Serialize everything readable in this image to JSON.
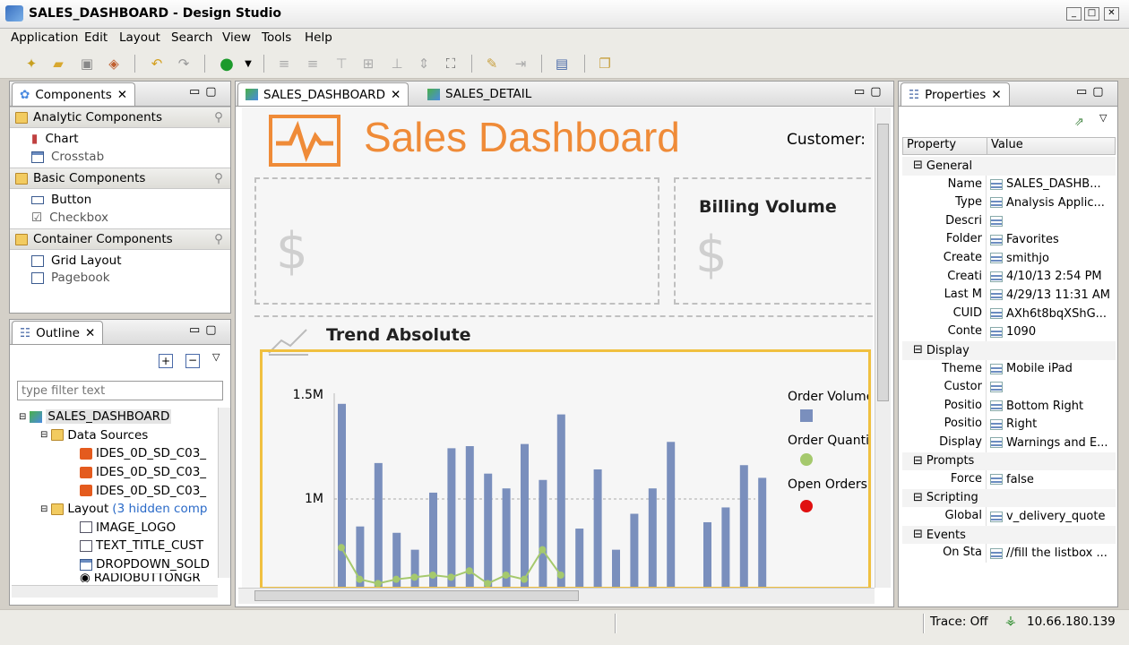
{
  "window": {
    "title": "SALES_DASHBOARD - Design Studio",
    "controls": [
      "_",
      "□",
      "✕"
    ]
  },
  "menu": [
    "Application",
    "Edit",
    "Layout",
    "Search",
    "View",
    "Tools",
    "Help"
  ],
  "components_panel": {
    "title": "Components",
    "groups": [
      {
        "label": "Analytic Components",
        "items": [
          "Chart",
          "Crosstab"
        ]
      },
      {
        "label": "Basic Components",
        "items": [
          "Button",
          "Checkbox"
        ]
      },
      {
        "label": "Container Components",
        "items": [
          "Grid Layout",
          "Pagebook"
        ]
      }
    ]
  },
  "outline_panel": {
    "title": "Outline",
    "filter_placeholder": "type filter text",
    "root": "SALES_DASHBOARD",
    "data_sources_label": "Data Sources",
    "data_sources": [
      "IDES_0D_SD_C03_",
      "IDES_0D_SD_C03_",
      "IDES_0D_SD_C03_"
    ],
    "layout_label": "Layout",
    "layout_hint": "(3 hidden comp",
    "layout_items": [
      "IMAGE_LOGO",
      "TEXT_TITLE_CUST",
      "DROPDOWN_SOLD",
      "RADIOBUTTONGR"
    ]
  },
  "editor": {
    "tabs": [
      "SALES_DASHBOARD",
      "SALES_DETAIL"
    ],
    "header_title": "Sales Dashboard",
    "customer_label": "Customer:",
    "billing_title": "Billing Volume",
    "dollar": "$",
    "trend_title": "Trend Absolute"
  },
  "chart_data": {
    "type": "bar",
    "ylabels": [
      "1.5M",
      "1M"
    ],
    "legend": [
      "Order Volume",
      "Order Quantit",
      "Open Orders"
    ],
    "colors": {
      "bar": "#7a8fbd",
      "line": "#a5c96d",
      "open": "#e01010"
    },
    "values": [
      1.45,
      0.87,
      1.17,
      0.84,
      0.76,
      1.03,
      1.24,
      1.25,
      1.12,
      1.05,
      1.26,
      1.09,
      1.4,
      0.86,
      1.14,
      0.76,
      0.93,
      1.05,
      1.27,
      0,
      0.89,
      0.96,
      1.16,
      1.1
    ],
    "line_values": [
      0.77,
      0.62,
      0.6,
      0.62,
      0.63,
      0.64,
      0.63,
      0.66,
      0.6,
      0.64,
      0.62,
      0.76,
      0.64
    ]
  },
  "properties": {
    "title": "Properties",
    "col_property": "Property",
    "col_value": "Value",
    "rows": [
      {
        "cat": "General"
      },
      {
        "k": "Name",
        "v": "SALES_DASHB..."
      },
      {
        "k": "Type",
        "v": "Analysis Applic..."
      },
      {
        "k": "Descri",
        "v": ""
      },
      {
        "k": "Folder",
        "v": "Favorites"
      },
      {
        "k": "Create",
        "v": "smithjo"
      },
      {
        "k": "Creati",
        "v": "4/10/13 2:54 PM"
      },
      {
        "k": "Last M",
        "v": "4/29/13 11:31 AM"
      },
      {
        "k": "CUID",
        "v": "AXh6t8bqXShG..."
      },
      {
        "k": "Conte",
        "v": "1090"
      },
      {
        "cat": "Display"
      },
      {
        "k": "Theme",
        "v": "Mobile iPad"
      },
      {
        "k": "Custor",
        "v": ""
      },
      {
        "k": "Positio",
        "v": "Bottom Right"
      },
      {
        "k": "Positio",
        "v": "Right"
      },
      {
        "k": "Display",
        "v": "Warnings and E..."
      },
      {
        "cat": "Prompts"
      },
      {
        "k": "Force",
        "v": "false"
      },
      {
        "cat": "Scripting"
      },
      {
        "k": "Global",
        "v": "v_delivery_quote"
      },
      {
        "cat": "Events"
      },
      {
        "k": "On Sta",
        "v": "//fill the listbox ..."
      }
    ]
  },
  "status": {
    "trace": "Trace: Off",
    "ip": "10.66.180.139"
  }
}
